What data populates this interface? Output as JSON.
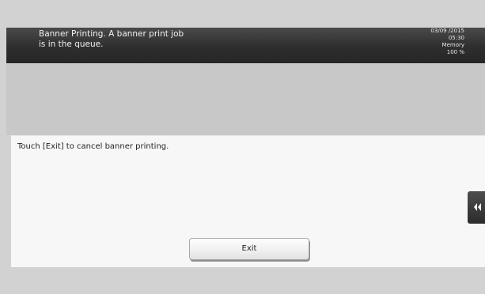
{
  "status_bar": {
    "message": "Banner Printing. A banner print job\nis in the queue.",
    "date": "03/09 /2015",
    "time": "05:30",
    "memory_label": "Memory",
    "memory_value": "100 %"
  },
  "panel": {
    "message": "Touch [Exit] to cancel banner printing.",
    "exit_label": "Exit"
  },
  "side_tab": {
    "icon": "double-chevron-left-icon"
  }
}
